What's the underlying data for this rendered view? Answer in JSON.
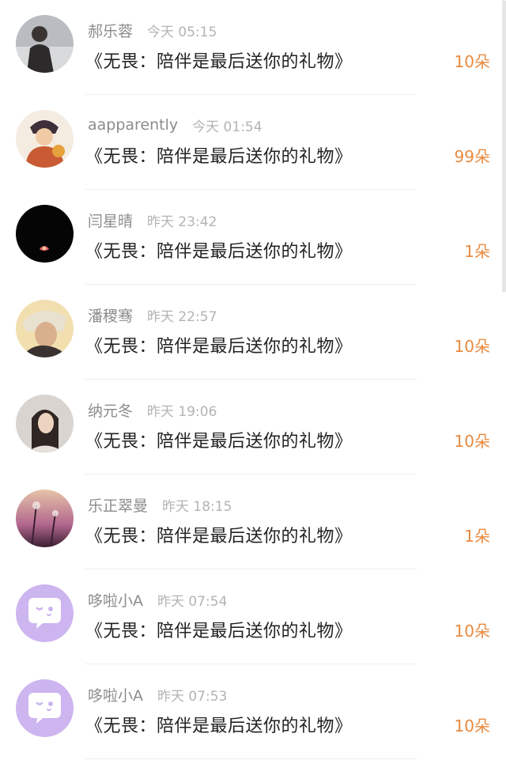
{
  "records": [
    {
      "name": "郝乐蓉",
      "time": "今天 05:15",
      "title": "《无畏：陪伴是最后送你的礼物》",
      "amount": "10朵",
      "avatar_icon": "photo-avatar-person-lake"
    },
    {
      "name": "aapparently",
      "time": "今天 01:54",
      "title": "《无畏：陪伴是最后送你的礼物》",
      "amount": "99朵",
      "avatar_icon": "illustrated-avatar-character"
    },
    {
      "name": "闫星晴",
      "time": "昨天 23:42",
      "title": "《无畏：陪伴是最后送你的礼物》",
      "amount": "1朵",
      "avatar_icon": "photo-avatar-dark-flower"
    },
    {
      "name": "潘稷骞",
      "time": "昨天 22:57",
      "title": "《无畏：陪伴是最后送你的礼物》",
      "amount": "10朵",
      "avatar_icon": "photo-avatar-blonde-person"
    },
    {
      "name": "纳元冬",
      "time": "昨天 19:06",
      "title": "《无畏：陪伴是最后送你的礼物》",
      "amount": "10朵",
      "avatar_icon": "photo-avatar-woman-portrait"
    },
    {
      "name": "乐正翠曼",
      "time": "昨天 18:15",
      "title": "《无畏：陪伴是最后送你的礼物》",
      "amount": "1朵",
      "avatar_icon": "photo-avatar-dandelion-sunset"
    },
    {
      "name": "哆啦小A",
      "time": "昨天 07:54",
      "title": "《无畏：陪伴是最后送你的礼物》",
      "amount": "10朵",
      "avatar_icon": "chat-bubble-default-avatar"
    },
    {
      "name": "哆啦小A",
      "time": "昨天 07:53",
      "title": "《无畏：陪伴是最后送你的礼物》",
      "amount": "10朵",
      "avatar_icon": "chat-bubble-default-avatar"
    }
  ],
  "colors": {
    "amount": "#e98a3f",
    "name": "#8c8c8c",
    "time": "#b3b3b3",
    "title": "#222222",
    "default_avatar": "#cdb5ef"
  }
}
